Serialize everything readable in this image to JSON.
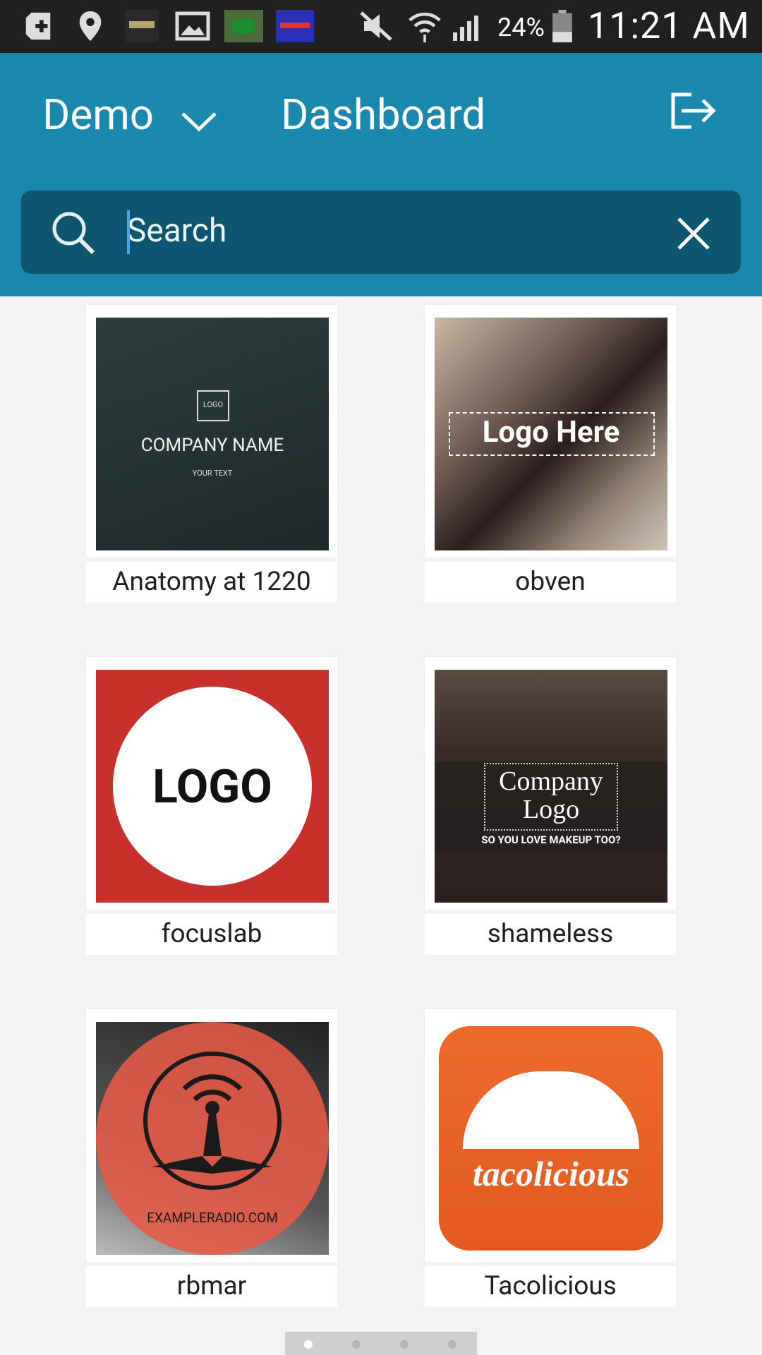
{
  "statusbar": {
    "battery_pct": "24%",
    "time": "11:21 AM"
  },
  "header": {
    "org_name": "Demo",
    "page_title": "Dashboard"
  },
  "search": {
    "placeholder": "Search"
  },
  "cards": [
    {
      "label": "Anatomy at 1220",
      "logo_lines": [
        "LOGO",
        "COMPANY NAME",
        "YOUR TEXT"
      ]
    },
    {
      "label": "obven",
      "logo_lines": [
        "Logo Here"
      ]
    },
    {
      "label": "focuslab",
      "logo_lines": [
        "LOGO"
      ]
    },
    {
      "label": "shameless",
      "logo_lines": [
        "Company",
        "Logo",
        "SO YOU LOVE MAKEUP TOO?"
      ]
    },
    {
      "label": "rbmar",
      "logo_lines": [
        "EXAMPLERADIO.COM"
      ]
    },
    {
      "label": "Tacolicious",
      "logo_lines": [
        "tacolicious"
      ]
    }
  ],
  "pager": {
    "pages": 4,
    "current": 1
  },
  "colors": {
    "header_bg": "#1a87ad",
    "search_bg": "#0e5670",
    "statusbar_bg": "#202020",
    "page_bg": "#f3f3f3"
  }
}
